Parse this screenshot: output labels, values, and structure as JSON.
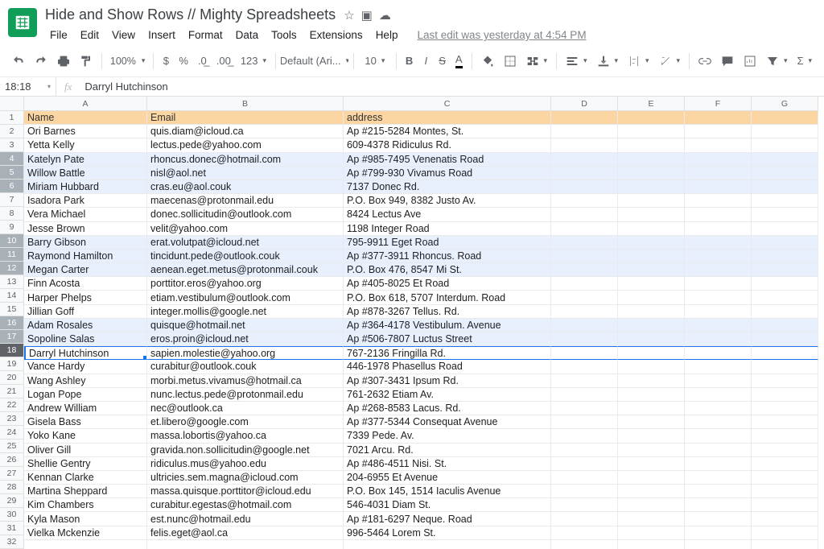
{
  "doc": {
    "title": "Hide and Show Rows // Mighty Spreadsheets"
  },
  "menus": {
    "file": "File",
    "edit": "Edit",
    "view": "View",
    "insert": "Insert",
    "format": "Format",
    "data": "Data",
    "tools": "Tools",
    "extensions": "Extensions",
    "help": "Help",
    "lastedit": "Last edit was yesterday at 4:54 PM"
  },
  "toolbar": {
    "zoom": "100%",
    "font": "Default (Ari...",
    "size": "10"
  },
  "fx": {
    "ref": "18:18",
    "val": "Darryl Hutchinson"
  },
  "cols": [
    "A",
    "B",
    "C",
    "D",
    "E",
    "F",
    "G"
  ],
  "hdr": {
    "name": "Name",
    "email": "Email",
    "address": "address"
  },
  "rows": [
    {
      "n": "Ori Barnes",
      "e": "quis.diam@icloud.ca",
      "a": "Ap #215-5284 Montes, St."
    },
    {
      "n": "Yetta Kelly",
      "e": "lectus.pede@yahoo.com",
      "a": "609-4378 Ridiculus Rd."
    },
    {
      "n": "Katelyn Pate",
      "e": "rhoncus.donec@hotmail.com",
      "a": "Ap #985-7495 Venenatis Road",
      "sel": true
    },
    {
      "n": "Willow Battle",
      "e": "nisl@aol.net",
      "a": "Ap #799-930 Vivamus Road",
      "sel": true
    },
    {
      "n": "Miriam Hubbard",
      "e": "cras.eu@aol.couk",
      "a": "7137 Donec Rd.",
      "sel": true
    },
    {
      "n": "Isadora Park",
      "e": "maecenas@protonmail.edu",
      "a": "P.O. Box 949, 8382 Justo Av."
    },
    {
      "n": "Vera Michael",
      "e": "donec.sollicitudin@outlook.com",
      "a": "8424 Lectus Ave"
    },
    {
      "n": "Jesse Brown",
      "e": "velit@yahoo.com",
      "a": "1198 Integer Road"
    },
    {
      "n": "Barry Gibson",
      "e": "erat.volutpat@icloud.net",
      "a": "795-9911 Eget Road",
      "sel": true
    },
    {
      "n": "Raymond Hamilton",
      "e": "tincidunt.pede@outlook.couk",
      "a": "Ap #377-3911 Rhoncus. Road",
      "sel": true
    },
    {
      "n": "Megan Carter",
      "e": "aenean.eget.metus@protonmail.couk",
      "a": "P.O. Box 476, 8547 Mi St.",
      "sel": true
    },
    {
      "n": "Finn Acosta",
      "e": "porttitor.eros@yahoo.org",
      "a": "Ap #405-8025 Et Road"
    },
    {
      "n": "Harper Phelps",
      "e": "etiam.vestibulum@outlook.com",
      "a": "P.O. Box 618, 5707 Interdum. Road"
    },
    {
      "n": "Jillian Goff",
      "e": "integer.mollis@google.net",
      "a": "Ap #878-3267 Tellus. Rd."
    },
    {
      "n": "Adam Rosales",
      "e": "quisque@hotmail.net",
      "a": "Ap #364-4178 Vestibulum. Avenue",
      "sel": true
    },
    {
      "n": "Sopoline Salas",
      "e": "eros.proin@icloud.net",
      "a": "Ap #506-7807 Luctus Street",
      "sel": true
    },
    {
      "n": "Darryl Hutchinson",
      "e": "sapien.molestie@yahoo.org",
      "a": "767-2136 Fringilla Rd.",
      "sel": true,
      "active": true
    },
    {
      "n": "Vance Hardy",
      "e": "curabitur@outlook.couk",
      "a": "446-1978 Phasellus Road"
    },
    {
      "n": "Wang Ashley",
      "e": "morbi.metus.vivamus@hotmail.ca",
      "a": "Ap #307-3431 Ipsum Rd."
    },
    {
      "n": "Logan Pope",
      "e": "nunc.lectus.pede@protonmail.edu",
      "a": "761-2632 Etiam Av."
    },
    {
      "n": "Andrew William",
      "e": "nec@outlook.ca",
      "a": "Ap #268-8583 Lacus. Rd."
    },
    {
      "n": "Gisela Bass",
      "e": "et.libero@google.com",
      "a": "Ap #377-5344 Consequat Avenue"
    },
    {
      "n": "Yoko Kane",
      "e": "massa.lobortis@yahoo.ca",
      "a": "7339 Pede. Av."
    },
    {
      "n": "Oliver Gill",
      "e": "gravida.non.sollicitudin@google.net",
      "a": "7021 Arcu. Rd."
    },
    {
      "n": "Shellie Gentry",
      "e": "ridiculus.mus@yahoo.edu",
      "a": "Ap #486-4511 Nisi. St."
    },
    {
      "n": "Kennan Clarke",
      "e": "ultricies.sem.magna@icloud.com",
      "a": "204-6955 Et Avenue"
    },
    {
      "n": "Martina Sheppard",
      "e": "massa.quisque.porttitor@icloud.edu",
      "a": "P.O. Box 145, 1514 Iaculis Avenue"
    },
    {
      "n": "Kim Chambers",
      "e": "curabitur.egestas@hotmail.com",
      "a": "546-4031 Diam St."
    },
    {
      "n": "Kyla Mason",
      "e": "est.nunc@hotmail.edu",
      "a": "Ap #181-6297 Neque. Road"
    },
    {
      "n": "Vielka Mckenzie",
      "e": "felis.eget@aol.ca",
      "a": "996-5464 Lorem St."
    },
    {
      "n": "",
      "e": "",
      "a": ""
    }
  ]
}
